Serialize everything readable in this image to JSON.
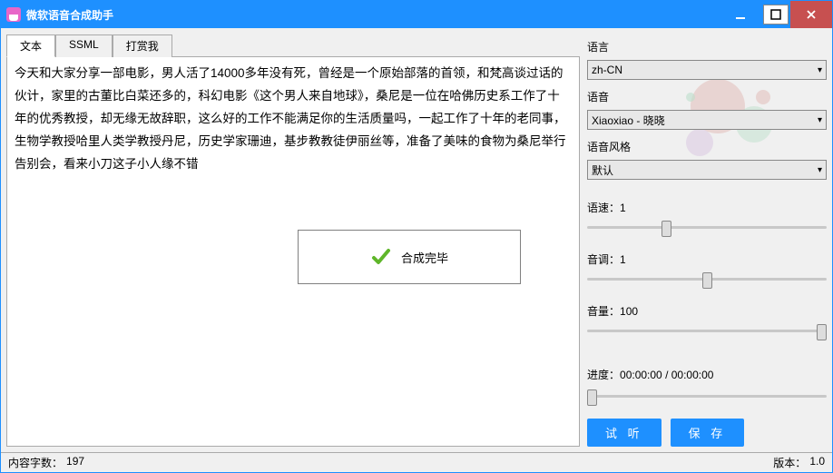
{
  "window": {
    "title": "微软语音合成助手"
  },
  "tabs": [
    {
      "label": "文本",
      "active": true
    },
    {
      "label": "SSML",
      "active": false
    },
    {
      "label": "打赏我",
      "active": false
    }
  ],
  "editor": {
    "text": "今天和大家分享一部电影，男人活了14000多年没有死，曾经是一个原始部落的首领，和梵高谈过话的伙计，家里的古董比白菜还多的，科幻电影《这个男人来自地球》，桑尼是一位在哈佛历史系工作了十年的优秀教授，却无缘无故辞职，这么好的工作不能满足你的生活质量吗，一起工作了十年的老同事，生物学教授哈里人类学教授丹尼，历史学家珊迪，基步教教徒伊丽丝等，准备了美味的食物为桑尼举行告别会，看来小刀这子小人缘不错"
  },
  "status_popup": {
    "message": "合成完毕"
  },
  "panel": {
    "language": {
      "label": "语言",
      "value": "zh-CN"
    },
    "voice": {
      "label": "语音",
      "value": "Xiaoxiao - 晓晓"
    },
    "style": {
      "label": "语音风格",
      "value": "默认"
    },
    "speed": {
      "label": "语速：",
      "value": "1",
      "pos_pct": 33
    },
    "pitch": {
      "label": "音调：",
      "value": "1",
      "pos_pct": 50
    },
    "volume": {
      "label": "音量：",
      "value": "100",
      "pos_pct": 100
    },
    "progress": {
      "label": "进度：",
      "current": "00:00:00",
      "sep": " / ",
      "total": "00:00:00",
      "pos_pct": 0
    },
    "buttons": {
      "preview": "试 听",
      "save": "保 存"
    }
  },
  "footer": {
    "count_label": "内容字数：",
    "count_value": "197",
    "version_label": "版本：",
    "version_value": "1.0"
  }
}
